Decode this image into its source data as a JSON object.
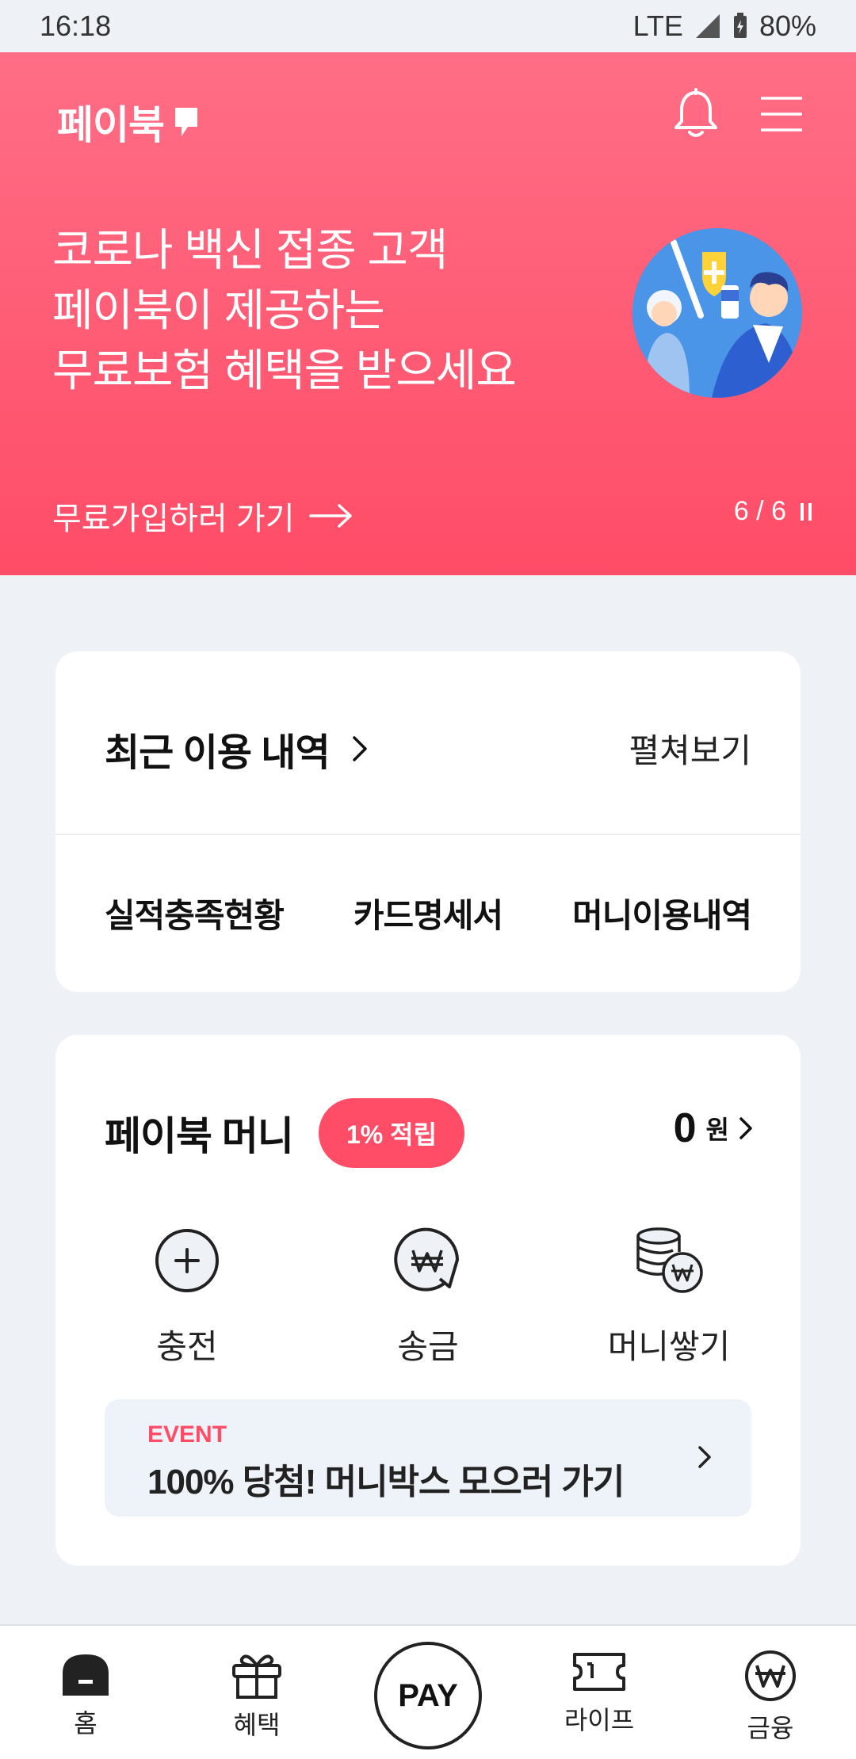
{
  "status": {
    "time": "16:18",
    "network": "LTE",
    "battery": "80%"
  },
  "header": {
    "logo": "페이북",
    "bell_icon": "bell-icon",
    "menu_icon": "hamburger-menu-icon"
  },
  "banner": {
    "lines": [
      "코로나 백신 접종 고객",
      "페이북이 제공하는",
      "무료보험 혜택을 받으세요"
    ],
    "link": "무료가입하러 가기",
    "pager": "6 / 6",
    "image_icon": "vaccine-illustration",
    "bg_colors": [
      "#ff6e86",
      "#ff4c67"
    ]
  },
  "recent": {
    "title": "최근 이용 내역",
    "expand": "펼쳐보기",
    "links": [
      "실적충족현황",
      "카드명세서",
      "머니이용내역"
    ]
  },
  "money": {
    "title": "페이북 머니",
    "badge": "1% 적립",
    "amount": "0",
    "unit": "원",
    "actions": [
      {
        "label": "충전",
        "icon": "plus-circle-icon"
      },
      {
        "label": "송금",
        "icon": "won-send-icon"
      },
      {
        "label": "머니쌓기",
        "icon": "coin-stack-icon"
      }
    ],
    "event": {
      "tag": "EVENT",
      "text": "100% 당첨! 머니박스 모으러 가기"
    }
  },
  "nav": [
    {
      "label": "홈",
      "icon": "home-icon"
    },
    {
      "label": "혜택",
      "icon": "gift-icon"
    },
    {
      "label": "PAY",
      "icon": "pay-button"
    },
    {
      "label": "라이프",
      "icon": "ticket-icon"
    },
    {
      "label": "금융",
      "icon": "won-circle-icon"
    }
  ],
  "colors": {
    "accent": "#ff4c67",
    "background": "#eef1f6"
  }
}
